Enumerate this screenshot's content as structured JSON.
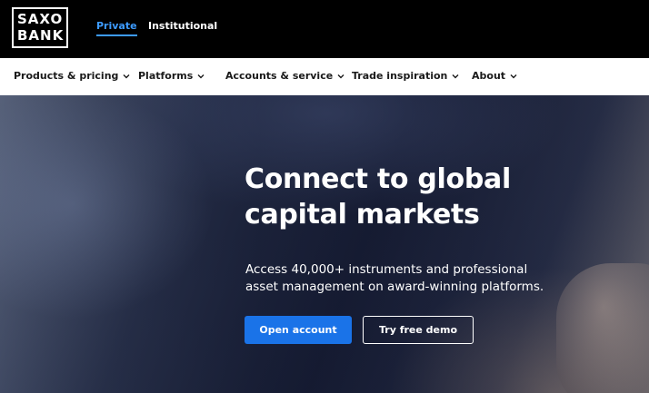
{
  "brand": {
    "line1": "SAXO",
    "line2": "BANK"
  },
  "segments": {
    "private": "Private",
    "institutional": "Institutional"
  },
  "nav": {
    "items": [
      {
        "label": "Products & pricing"
      },
      {
        "label": "Platforms"
      },
      {
        "label": "Accounts & service"
      },
      {
        "label": "Trade inspiration"
      },
      {
        "label": "About"
      }
    ]
  },
  "hero": {
    "headline_line1": "Connect to global",
    "headline_line2": "capital markets",
    "subtext_line1": "Access 40,000+ instruments and professional",
    "subtext_line2": "asset management on award-winning platforms.",
    "primary_button": "Open account",
    "secondary_button": "Try free demo"
  },
  "colors": {
    "accent": "#3d9bff",
    "primary_button": "#1a73e8",
    "topbar": "#000000",
    "navbar": "#ffffff"
  },
  "icons": {
    "nav_chevron": "chevron-down-icon"
  }
}
